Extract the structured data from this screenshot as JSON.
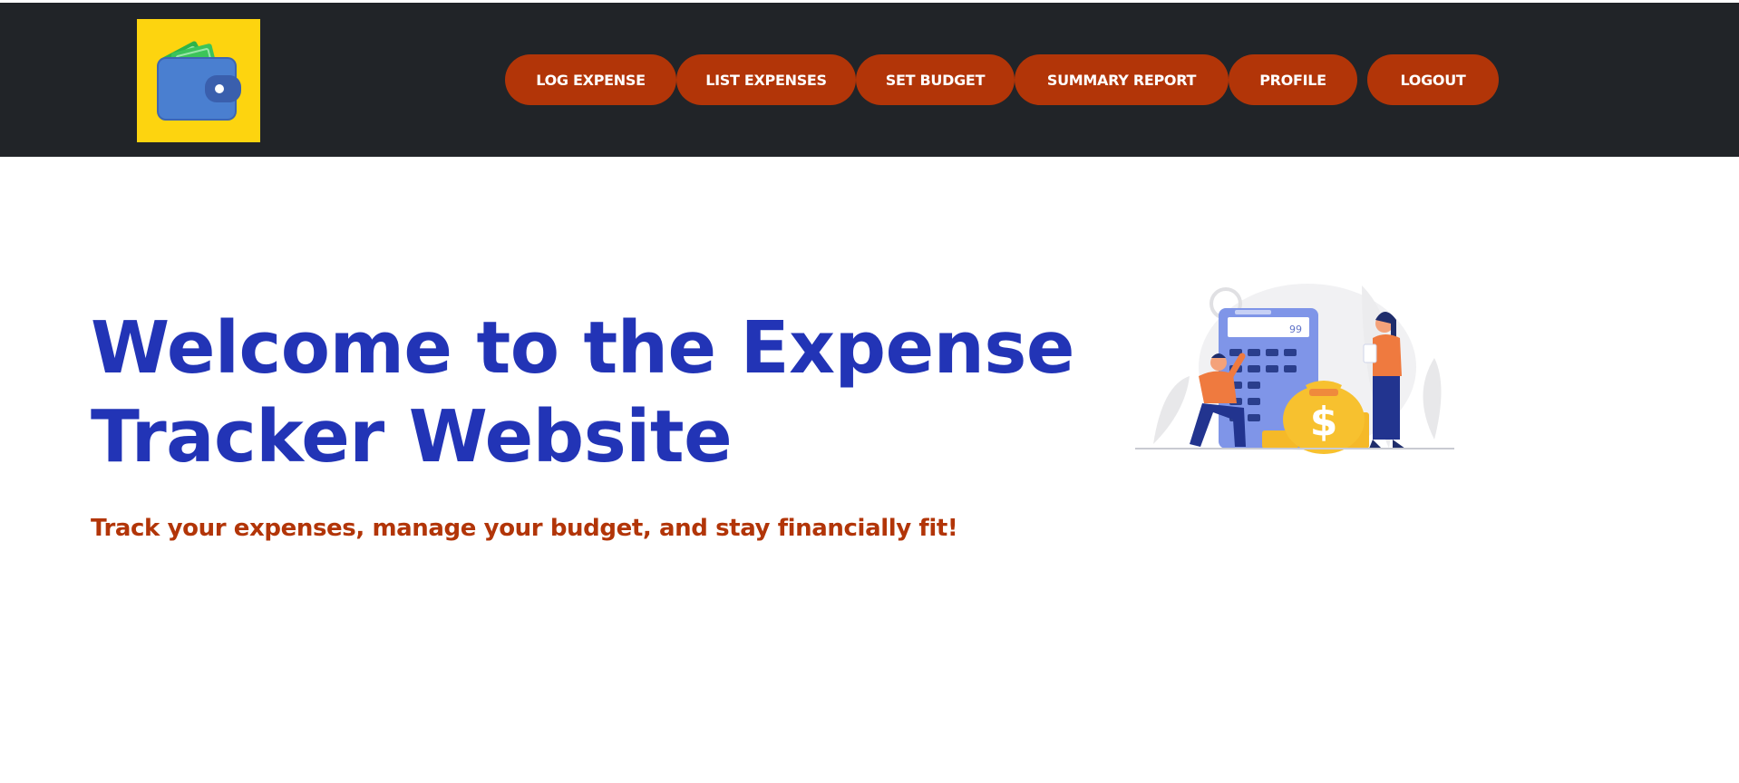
{
  "nav": {
    "logo_icon": "wallet-icon",
    "items": [
      {
        "label": "LOG EXPENSE"
      },
      {
        "label": "LIST EXPENSES"
      },
      {
        "label": "SET BUDGET"
      },
      {
        "label": "SUMMARY REPORT"
      },
      {
        "label": "PROFILE"
      },
      {
        "label": "LOGOUT"
      }
    ]
  },
  "hero": {
    "title_line1": "Welcome to the Expense",
    "title_line2": "Tracker Website",
    "subtitle": "Track your expenses, manage your budget, and stay financially fit!",
    "illustration_display": "99",
    "illustration_icon": "money-bag-calculator-illustration"
  },
  "colors": {
    "navbar_bg": "#212428",
    "button_bg": "#b23508",
    "logo_bg": "#fdd40f",
    "title": "#2234b6",
    "subtitle": "#b23508"
  }
}
